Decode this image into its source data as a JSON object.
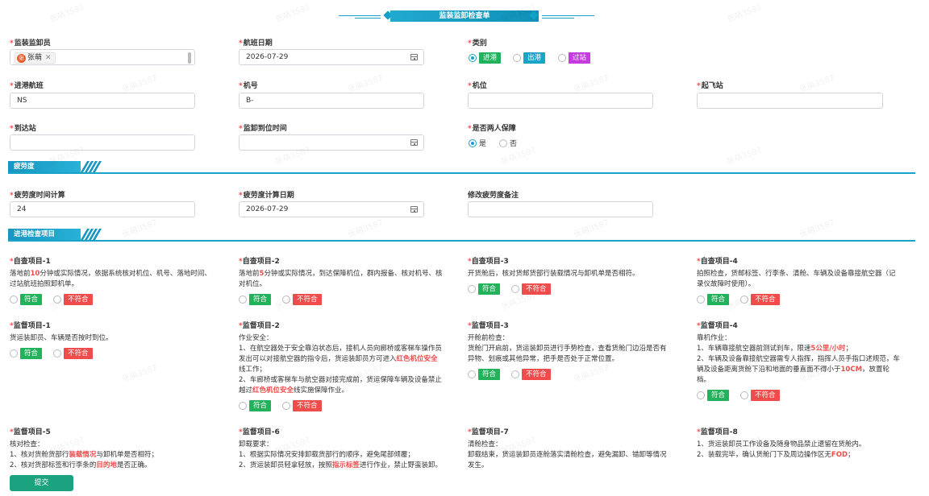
{
  "title": "监装监卸检查单",
  "fields": {
    "supervisor_label": "监装监卸员",
    "supervisor_tag": "张萌",
    "supervisor_avatar": "张",
    "flight_date_label": "航班日期",
    "flight_date_value": "2026-07-29",
    "category_label": "类别",
    "category_options": [
      "进港",
      "出港",
      "过站"
    ],
    "inbound_flight_label": "进港航班",
    "inbound_flight_value": "NS",
    "aircraft_label": "机号",
    "aircraft_value": "B-",
    "stand_label": "机位",
    "origin_label": "起飞站",
    "arrival_label": "到达站",
    "arrive_time_label": "监卸到位时间",
    "two_person_label": "是否两人保障",
    "two_person_options": [
      "是",
      "否"
    ]
  },
  "fatigue": {
    "section_title": "疲劳度",
    "calc_label": "疲劳度时间计算",
    "calc_value": "24",
    "date_label": "疲劳度计算日期",
    "date_value": "2026-07-29",
    "remark_label": "修改疲劳度备注"
  },
  "inbound": {
    "section_title": "进港检查项目",
    "pass_label": "符合",
    "fail_label": "不符合",
    "items": [
      {
        "title": "自查项目-1",
        "lines": [
          "落地前10分钟或实际情况，依据系统核对机位、机号、落地时间、",
          "过站航班拍照卸机单。"
        ]
      },
      {
        "title": "自查项目-2",
        "lines": [
          "落地前5分钟或实际情况，到达保障机位，群内报备、核对机号、核",
          "对机位。"
        ]
      },
      {
        "title": "自查项目-3",
        "lines": [
          "开货舱后，核对货邮货部行装载情况与卸机单是否相符。"
        ]
      },
      {
        "title": "自查项目-4",
        "lines": [
          "拍照检查，货邮标签、行李条、清舱、车辆及设备靠接航空器（记",
          "录仪故障时使用）。"
        ]
      },
      {
        "title": "监督项目-1",
        "lines": [
          "货运装卸员、车辆是否按时到位。"
        ]
      },
      {
        "title": "监督项目-2",
        "lines": [
          "作业安全：",
          "1、在航空器处于安全靠泊状态后，接机人员向廊桥或客梯车操作员",
          "发出可以对接航空器的指令后，货运装卸员方可进入红色机位安全",
          "线工作；",
          "2、车廊桥或客梯车与航空器对接完成前，货运保障车辆及设备禁止",
          "越过红色机位安全线实施保障作业。"
        ]
      },
      {
        "title": "监督项目-3",
        "lines": [
          "开舱前检查：",
          "货舱门开启前，货运装卸员进行手势检查，查看货舱门边沿是否有",
          "异物、划痕或其他异常，把手是否处于正常位置。"
        ]
      },
      {
        "title": "监督项目-4",
        "lines": [
          "靠机作业：",
          "1、车辆靠接航空器前测试刹车，限速5公里/小时；",
          "2、车辆及设备靠接航空器需专人指挥，指挥人员手指口述规范，车",
          "辆及设备距离货舱下沿和地面的垂直面不得小于10CM，放置轮",
          "档。"
        ]
      },
      {
        "title": "监督项目-5",
        "lines": [
          "核对检查：",
          "1、核对货舱货部行装载情况与卸机单是否相符；",
          "2、核对货部标签和行李条的目的地是否正确。"
        ]
      },
      {
        "title": "监督项目-6",
        "lines": [
          "卸载要求：",
          "1、根据实际情况安排卸载货部行的顺序，避免尾部倾覆；",
          "2、货运装卸员轻拿轻放，按照指示标签进行作业，禁止野蛮装卸。"
        ]
      },
      {
        "title": "监督项目-7",
        "lines": [
          "清舱检查：",
          "卸载结束，货运装卸员逐舱落实清舱检查，避免漏卸、错卸等情况",
          "发生。"
        ]
      },
      {
        "title": "监督项目-8",
        "lines": [
          "1、货运装卸员工作设备及随身物品禁止遗留在货舱内。",
          "2、装载完毕，确认货舱门下及周边操作区无FOD；"
        ]
      }
    ]
  },
  "watermark": "张萌3587",
  "submit_label": "提交",
  "colors": {
    "accent": "#1aa3c8",
    "pass": "#23b25c",
    "fail": "#f04c4c",
    "submit": "#1aa37e"
  }
}
